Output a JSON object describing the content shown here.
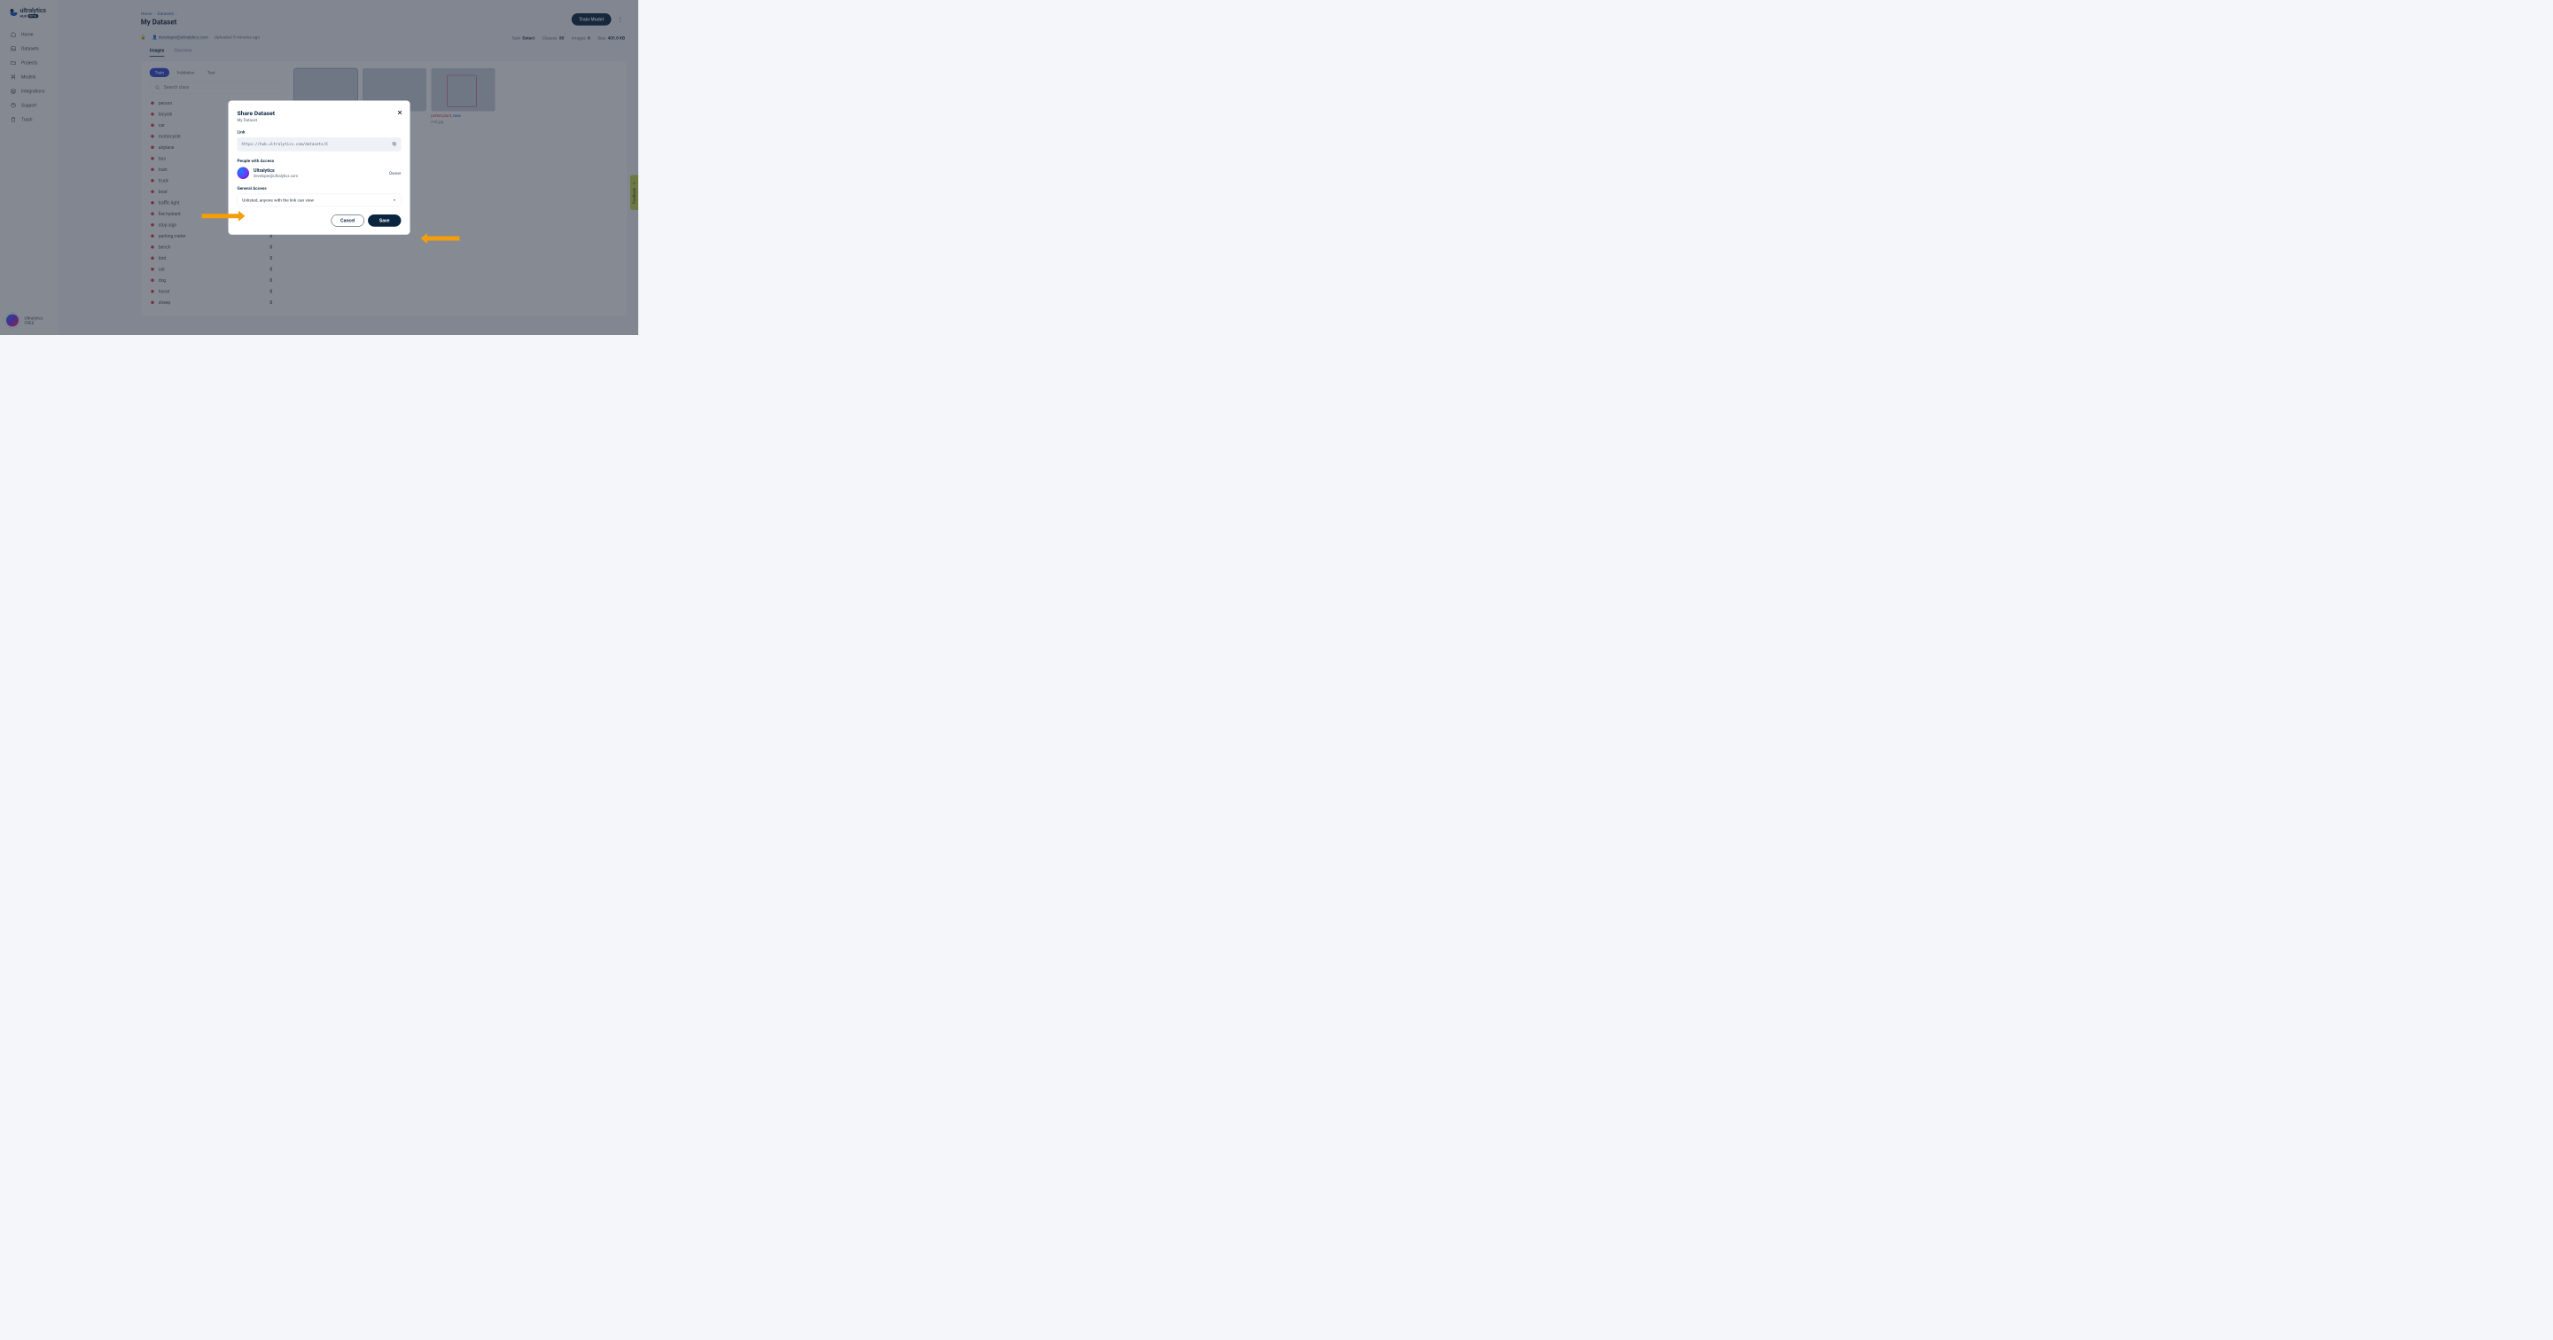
{
  "brand": {
    "name": "ultralytics",
    "hub": "HUB",
    "beta": "BETA"
  },
  "sidebar": {
    "items": [
      {
        "label": "Home"
      },
      {
        "label": "Datasets"
      },
      {
        "label": "Projects"
      },
      {
        "label": "Models"
      },
      {
        "label": "Integrations"
      },
      {
        "label": "Support"
      },
      {
        "label": "Trash"
      }
    ],
    "user": {
      "name": "Ultralytics",
      "plan": "FREE"
    }
  },
  "breadcrumb": {
    "home": "Home",
    "datasets": "Datasets"
  },
  "page_title": "My Dataset",
  "uploader": "developer@ultralytics.com",
  "uploaded": "Uploaded 5 minutes ago",
  "train_button": "Train Model",
  "stats": {
    "task_label": "Task",
    "task": "Detect",
    "classes_label": "Classes",
    "classes": "80",
    "images_label": "Images",
    "images": "6",
    "size_label": "Size",
    "size": "405.6 KB"
  },
  "page_tabs": [
    {
      "label": "Images",
      "active": true
    },
    {
      "label": "Overview",
      "active": false
    }
  ],
  "split_tabs": [
    {
      "label": "Train",
      "active": true
    },
    {
      "label": "Validation",
      "active": false
    },
    {
      "label": "Test",
      "active": false
    }
  ],
  "search_placeholder": "Search class",
  "classes": [
    {
      "name": "person"
    },
    {
      "name": "bicycle"
    },
    {
      "name": "car"
    },
    {
      "name": "motorcycle"
    },
    {
      "name": "airplane"
    },
    {
      "name": "bus"
    },
    {
      "name": "train"
    },
    {
      "name": "truck"
    },
    {
      "name": "boat"
    },
    {
      "name": "traffic light"
    },
    {
      "name": "fire hydrant"
    },
    {
      "name": "stop sign"
    },
    {
      "name": "parking meter",
      "count": "0"
    },
    {
      "name": "bench",
      "count": "0"
    },
    {
      "name": "bird",
      "count": "0"
    },
    {
      "name": "cat",
      "count": "0"
    },
    {
      "name": "dog",
      "count": "0"
    },
    {
      "name": "horse",
      "count": "0"
    },
    {
      "name": "sheep",
      "count": "0"
    }
  ],
  "thumbs": [
    {
      "file": "",
      "tags": ""
    },
    {
      "file": "",
      "tags": ""
    },
    {
      "file": "im0.jpg",
      "tag1": "potted plant",
      "tag2": "vase"
    }
  ],
  "modal": {
    "title": "Share Dataset",
    "subtitle": "My Dataset",
    "link_label": "Link",
    "link_url": "https://hub.ultralytics.com/datasets/X",
    "access_label": "People with Access",
    "access_user": {
      "name": "Ultralytics",
      "email": "developer@ultralytics.com",
      "role": "Owner"
    },
    "general_label": "General Access",
    "general_value": "Unlisted, anyone with the link can view",
    "cancel": "Cancel",
    "save": "Save"
  },
  "feedback": "Feedback"
}
